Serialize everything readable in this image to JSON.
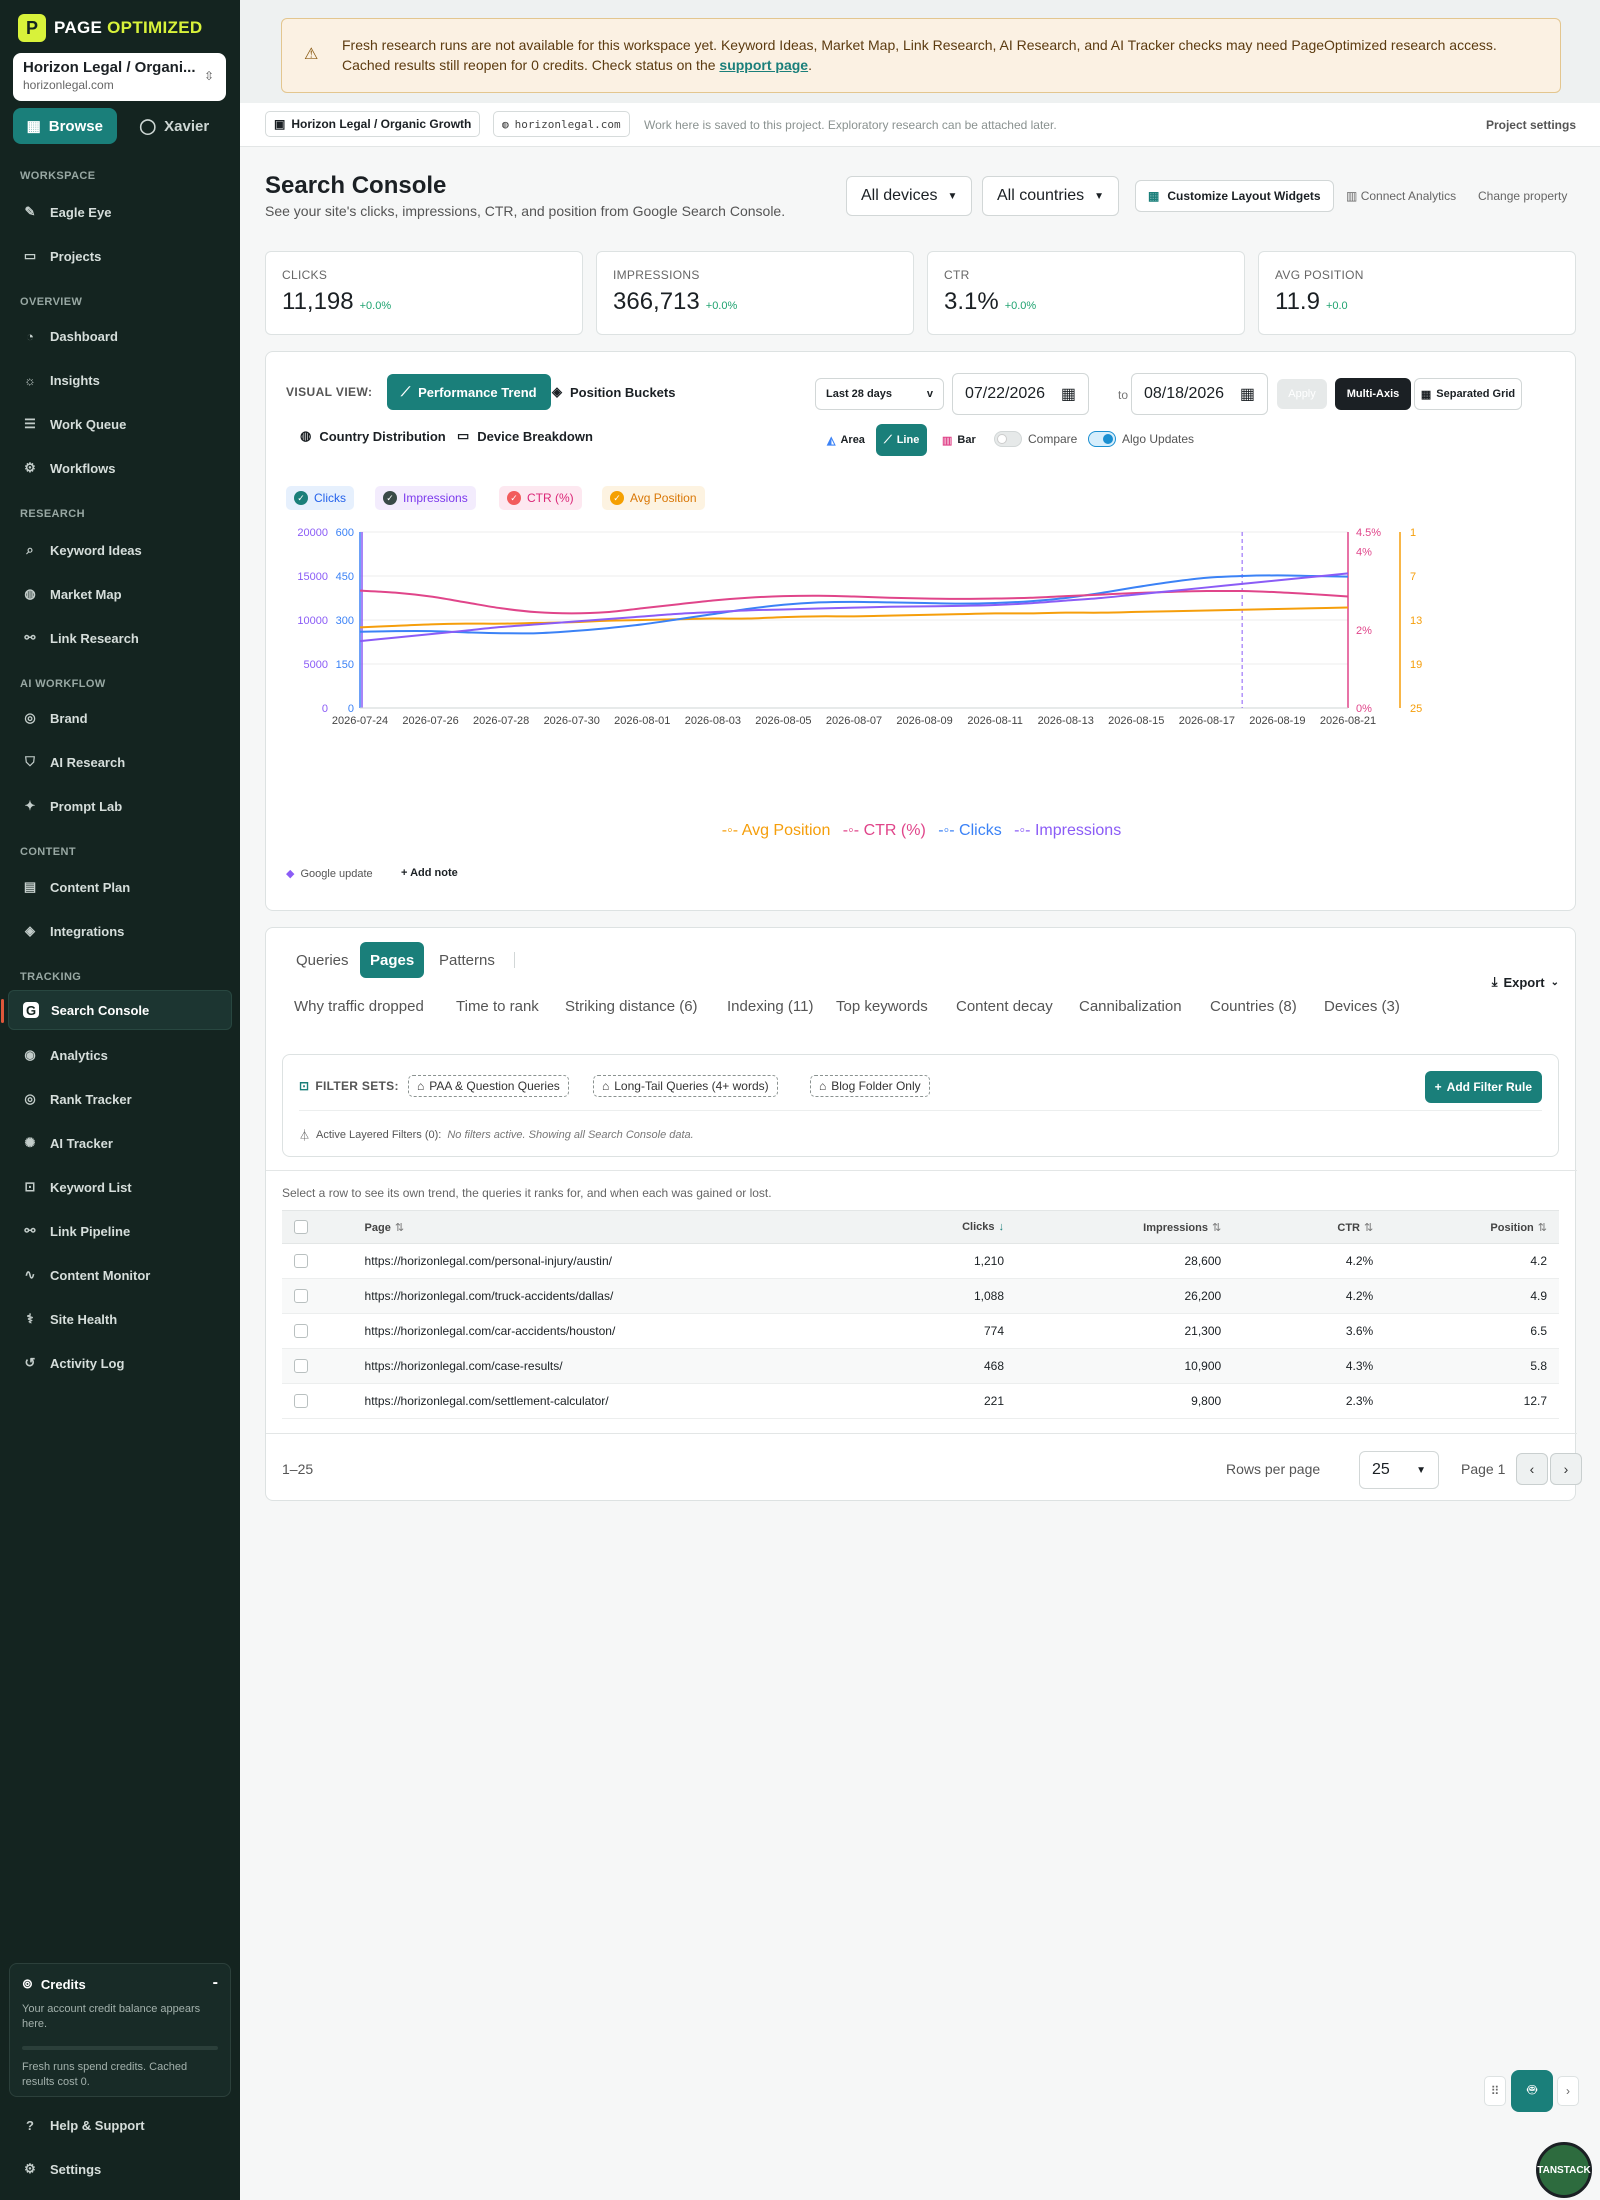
{
  "brand": {
    "name_part1": "PAGE",
    "name_part2": "OPTIMIZED",
    "mark": "P"
  },
  "workspace": {
    "name": "Horizon Legal / Organi...",
    "domain": "horizonlegal.com"
  },
  "modes": [
    {
      "label": "Browse",
      "icon": "grid-icon"
    },
    {
      "label": "Xavier",
      "icon": "chat-icon"
    }
  ],
  "sidebar": {
    "sections": {
      "workspace": "WORKSPACE",
      "overview": "OVERVIEW",
      "research": "RESEARCH",
      "ai_workflow": "AI WORKFLOW",
      "content": "CONTENT",
      "tracking": "TRACKING"
    },
    "items": [
      {
        "label": "Eagle Eye",
        "icon": "eagle-icon"
      },
      {
        "label": "Projects",
        "icon": "folder-icon"
      },
      {
        "label": "Dashboard",
        "icon": "gauge-icon"
      },
      {
        "label": "Insights",
        "icon": "bulb-icon"
      },
      {
        "label": "Work Queue",
        "icon": "list-icon"
      },
      {
        "label": "Workflows",
        "icon": "workflow-icon"
      },
      {
        "label": "Keyword Ideas",
        "icon": "search-icon"
      },
      {
        "label": "Market Map",
        "icon": "globe-icon"
      },
      {
        "label": "Link Research",
        "icon": "link-icon"
      },
      {
        "label": "Brand",
        "icon": "brand-icon"
      },
      {
        "label": "AI Research",
        "icon": "shield-icon"
      },
      {
        "label": "Prompt Lab",
        "icon": "sparkle-icon"
      },
      {
        "label": "Content Plan",
        "icon": "calendar-icon"
      },
      {
        "label": "Integrations",
        "icon": "layers-icon"
      },
      {
        "label": "Search Console",
        "icon": "google-icon"
      },
      {
        "label": "Analytics",
        "icon": "analytics-icon"
      },
      {
        "label": "Rank Tracker",
        "icon": "target-icon"
      },
      {
        "label": "AI Tracker",
        "icon": "ai-tracker-icon"
      },
      {
        "label": "Keyword List",
        "icon": "bookmark-icon"
      },
      {
        "label": "Link Pipeline",
        "icon": "pipeline-icon"
      },
      {
        "label": "Content Monitor",
        "icon": "pulse-icon"
      },
      {
        "label": "Site Health",
        "icon": "health-icon"
      },
      {
        "label": "Activity Log",
        "icon": "history-icon"
      }
    ],
    "credits": {
      "title": "Credits",
      "collapse": "-",
      "desc": "Your account credit balance appears here.",
      "note": "Fresh runs spend credits. Cached results cost 0."
    },
    "footer": [
      {
        "label": "Help & Support",
        "icon": "help-icon"
      },
      {
        "label": "Settings",
        "icon": "settings-icon"
      }
    ]
  },
  "alert": {
    "text": "Fresh research runs are not available for this workspace yet. Keyword Ideas, Market Map, Link Research, AI Research, and AI Tracker checks may need PageOptimized research access. Cached results still reopen for 0 credits. Check status on the ",
    "link": "support page",
    "end": "."
  },
  "context": {
    "project": "Horizon Legal / Organic Growth",
    "domain": "horizonlegal.com",
    "note": "Work here is saved to this project. Exploratory research can be attached later.",
    "settings": "Project settings"
  },
  "header": {
    "title": "Search Console",
    "subtitle": "See your site's clicks, impressions, CTR, and position from Google Search Console.",
    "devices": "All devices",
    "countries": "All countries",
    "customize": "Customize Layout Widgets",
    "connect": "Connect Analytics",
    "change": "Change property"
  },
  "metrics": [
    {
      "label": "CLICKS",
      "value": "11,198",
      "delta": "+0.0%"
    },
    {
      "label": "IMPRESSIONS",
      "value": "366,713",
      "delta": "+0.0%"
    },
    {
      "label": "CTR",
      "value": "3.1%",
      "delta": "+0.0%"
    },
    {
      "label": "AVG POSITION",
      "value": "11.9",
      "delta": "+0.0"
    }
  ],
  "chart_controls": {
    "visual_view": "VISUAL VIEW:",
    "views": [
      "Performance Trend",
      "Position Buckets",
      "Country Distribution",
      "Device Breakdown"
    ],
    "range": "Last 28 days",
    "date_from": "07/22/2026",
    "to": "to",
    "date_to": "08/18/2026",
    "apply": "Apply",
    "multi_axis": "Multi-Axis",
    "separated": "Separated Grid",
    "types": [
      "Area",
      "Line",
      "Bar"
    ],
    "compare": "Compare",
    "algo": "Algo Updates",
    "series_chips": [
      "Clicks",
      "Impressions",
      "CTR (%)",
      "Avg Position"
    ],
    "google_update": "Google update",
    "add_note": "Add note"
  },
  "colors": {
    "clicks": "#3b82f6",
    "impressions": "#8b5cf6",
    "ctr": "#e0458a",
    "position": "#f59e0b",
    "accent": "#1a7f7a"
  },
  "chart_data": {
    "type": "line",
    "x": [
      "2026-07-24",
      "2026-07-25",
      "2026-07-26",
      "2026-07-27",
      "2026-07-28",
      "2026-07-29",
      "2026-07-30",
      "2026-07-31",
      "2026-08-01",
      "2026-08-02",
      "2026-08-03",
      "2026-08-04",
      "2026-08-05",
      "2026-08-06",
      "2026-08-07",
      "2026-08-08",
      "2026-08-09",
      "2026-08-10",
      "2026-08-11",
      "2026-08-12",
      "2026-08-13",
      "2026-08-14",
      "2026-08-15",
      "2026-08-16",
      "2026-08-17",
      "2026-08-18",
      "2026-08-19",
      "2026-08-20",
      "2026-08-21"
    ],
    "x_tick_labels": [
      "2026-07-24",
      "2026-07-26",
      "2026-07-28",
      "2026-07-30",
      "2026-08-01",
      "2026-08-03",
      "2026-08-05",
      "2026-08-07",
      "2026-08-09",
      "2026-08-11",
      "2026-08-13",
      "2026-08-15",
      "2026-08-17",
      "2026-08-19",
      "2026-08-21"
    ],
    "series": [
      {
        "name": "Clicks",
        "axis": "clicks",
        "values": [
          260,
          262,
          262,
          258,
          255,
          255,
          262,
          272,
          285,
          302,
          320,
          338,
          352,
          360,
          362,
          360,
          358,
          356,
          358,
          364,
          375,
          392,
          412,
          430,
          444,
          450,
          452,
          450,
          448
        ]
      },
      {
        "name": "Impressions",
        "axis": "impressions",
        "values": [
          7600,
          8000,
          8400,
          8800,
          9200,
          9500,
          9800,
          10100,
          10400,
          10700,
          10900,
          11100,
          11200,
          11300,
          11400,
          11500,
          11550,
          11600,
          11700,
          11900,
          12200,
          12500,
          12900,
          13300,
          13700,
          14100,
          14500,
          14900,
          15300
        ]
      },
      {
        "name": "CTR (%)",
        "axis": "ctr",
        "values": [
          3.0,
          2.95,
          2.85,
          2.7,
          2.55,
          2.45,
          2.42,
          2.45,
          2.55,
          2.65,
          2.75,
          2.82,
          2.86,
          2.87,
          2.85,
          2.82,
          2.8,
          2.79,
          2.8,
          2.82,
          2.86,
          2.9,
          2.94,
          2.97,
          2.99,
          2.99,
          2.96,
          2.91,
          2.85
        ]
      },
      {
        "name": "Avg Position",
        "axis": "position",
        "values": [
          14.0,
          13.8,
          13.6,
          13.5,
          13.5,
          13.4,
          13.3,
          13.1,
          13.0,
          12.9,
          12.8,
          12.8,
          12.6,
          12.5,
          12.5,
          12.4,
          12.3,
          12.2,
          12.1,
          12.1,
          12.0,
          12.0,
          11.9,
          11.8,
          11.7,
          11.6,
          11.5,
          11.4,
          11.3
        ]
      }
    ],
    "axes": {
      "clicks": {
        "min": 0,
        "max": 600,
        "ticks": [
          0,
          150,
          300,
          450,
          600
        ]
      },
      "impressions": {
        "min": 0,
        "max": 20000,
        "ticks": [
          0,
          5000,
          10000,
          15000,
          20000
        ]
      },
      "ctr": {
        "min": 0,
        "max": 4.5,
        "tick_labels": [
          "0%",
          "2%",
          "4%",
          "4.5%"
        ],
        "tick_values": [
          0,
          2,
          4,
          4.5
        ]
      },
      "position": {
        "min": 1,
        "max": 25,
        "reversed": true,
        "ticks": [
          1,
          7,
          13,
          19,
          25
        ]
      }
    },
    "legend": [
      "Avg Position",
      "CTR (%)",
      "Clicks",
      "Impressions"
    ],
    "legend_placement": "bottom",
    "grid": true,
    "marker_date": "2026-08-18"
  },
  "table_section": {
    "tabs": [
      "Queries",
      "Pages",
      "Patterns"
    ],
    "export": "Export",
    "sub_tabs": [
      "Why traffic dropped",
      "Time to rank",
      "Striking distance (6)",
      "Indexing (11)",
      "Top keywords",
      "Content decay",
      "Cannibalization",
      "Countries (8)",
      "Devices (3)"
    ],
    "filter_sets_label": "FILTER SETS:",
    "filter_sets": [
      "PAA & Question Queries",
      "Long-Tail Queries (4+ words)",
      "Blog Folder Only"
    ],
    "add_filter": "Add Filter Rule",
    "active_label": "Active Layered Filters (0):",
    "active_note": "No filters active. Showing all Search Console data.",
    "row_hint": "Select a row to see its own trend, the queries it ranks for, and when each was gained or lost.",
    "columns": [
      "Page",
      "Clicks",
      "Impressions",
      "CTR",
      "Position"
    ],
    "rows": [
      {
        "page": "https://horizonlegal.com/personal-injury/austin/",
        "clicks": "1,210",
        "impressions": "28,600",
        "ctr": "4.2%",
        "position": "4.2"
      },
      {
        "page": "https://horizonlegal.com/truck-accidents/dallas/",
        "clicks": "1,088",
        "impressions": "26,200",
        "ctr": "4.2%",
        "position": "4.9"
      },
      {
        "page": "https://horizonlegal.com/car-accidents/houston/",
        "clicks": "774",
        "impressions": "21,300",
        "ctr": "3.6%",
        "position": "6.5"
      },
      {
        "page": "https://horizonlegal.com/case-results/",
        "clicks": "468",
        "impressions": "10,900",
        "ctr": "4.3%",
        "position": "5.8"
      },
      {
        "page": "https://horizonlegal.com/settlement-calculator/",
        "clicks": "221",
        "impressions": "9,800",
        "ctr": "2.3%",
        "position": "12.7"
      }
    ],
    "range": "1–25",
    "rows_per_page_label": "Rows per page",
    "rows_per_page": "25",
    "page": "Page 1"
  },
  "badge": "TANSTACK"
}
